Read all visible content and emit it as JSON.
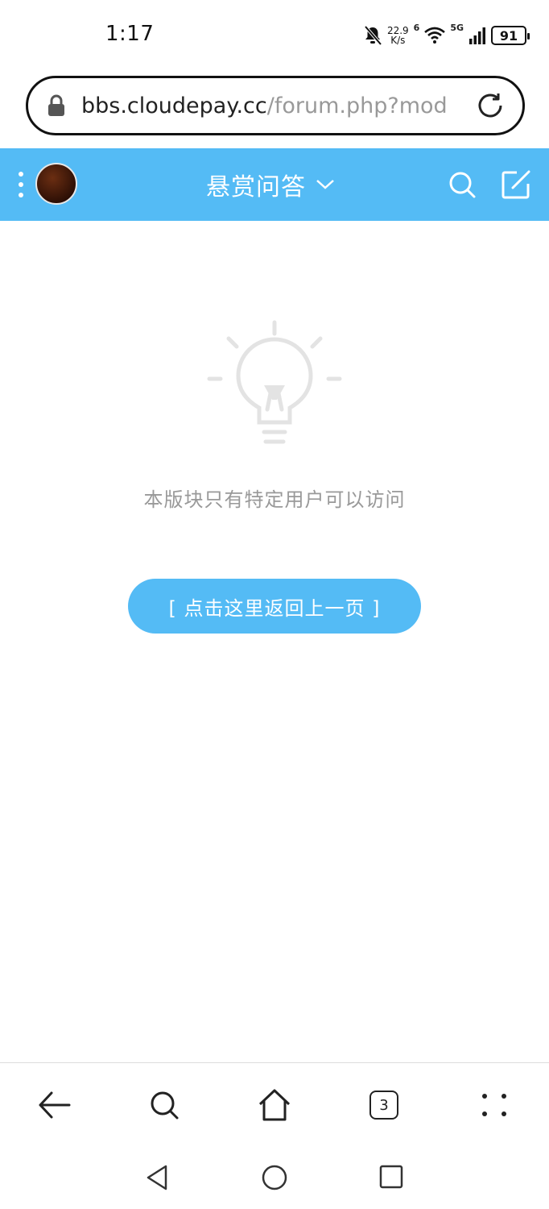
{
  "status_bar": {
    "time": "1:17",
    "net_speed_value": "22.9",
    "net_speed_unit": "K/s",
    "wifi_label": "6",
    "signal_label": "5G",
    "battery": "91"
  },
  "url_bar": {
    "domain": "bbs.cloudepay.cc",
    "path": "/forum.php?mod"
  },
  "header": {
    "title": "悬赏问答"
  },
  "main": {
    "notice": "本版块只有特定用户可以访问",
    "back_button": "[ 点击这里返回上一页 ]"
  },
  "toolbar": {
    "tab_count": "3"
  },
  "colors": {
    "accent": "#54bbf5",
    "muted_text": "#999999"
  }
}
